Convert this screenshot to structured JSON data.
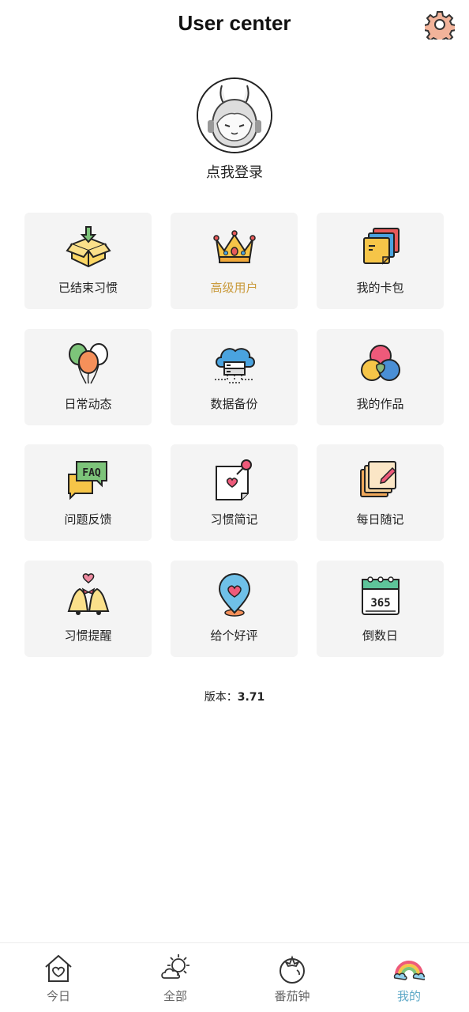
{
  "header": {
    "title": "User center",
    "settings_icon": "gear-icon"
  },
  "profile": {
    "login_label": "点我登录",
    "avatar_icon": "bunny-girl-avatar"
  },
  "menu": [
    {
      "label": "已结束习惯",
      "icon": "box-download-icon"
    },
    {
      "label": "高级用户",
      "icon": "crown-icon",
      "highlight_color": "#c99a3b"
    },
    {
      "label": "我的卡包",
      "icon": "card-stack-icon"
    },
    {
      "label": "日常动态",
      "icon": "balloons-icon"
    },
    {
      "label": "数据备份",
      "icon": "cloud-server-icon"
    },
    {
      "label": "我的作品",
      "icon": "color-circles-icon"
    },
    {
      "label": "问题反馈",
      "icon": "faq-bubble-icon"
    },
    {
      "label": "习惯简记",
      "icon": "pinned-note-icon"
    },
    {
      "label": "每日随记",
      "icon": "sticky-notes-icon"
    },
    {
      "label": "习惯提醒",
      "icon": "bells-icon"
    },
    {
      "label": "给个好评",
      "icon": "heart-pin-icon"
    },
    {
      "label": "倒数日",
      "icon": "calendar-365-icon"
    }
  ],
  "version": {
    "label": "版本：",
    "value": "3.71"
  },
  "tabs": [
    {
      "label": "今日",
      "icon": "home-heart-icon",
      "active": false
    },
    {
      "label": "全部",
      "icon": "sun-cloud-icon",
      "active": false
    },
    {
      "label": "番茄钟",
      "icon": "tomato-icon",
      "active": false
    },
    {
      "label": "我的",
      "icon": "rainbow-icon",
      "active": true
    }
  ],
  "colors": {
    "accent": "#5fa9c7",
    "gold": "#c99a3b",
    "card_bg": "#f4f4f4"
  }
}
